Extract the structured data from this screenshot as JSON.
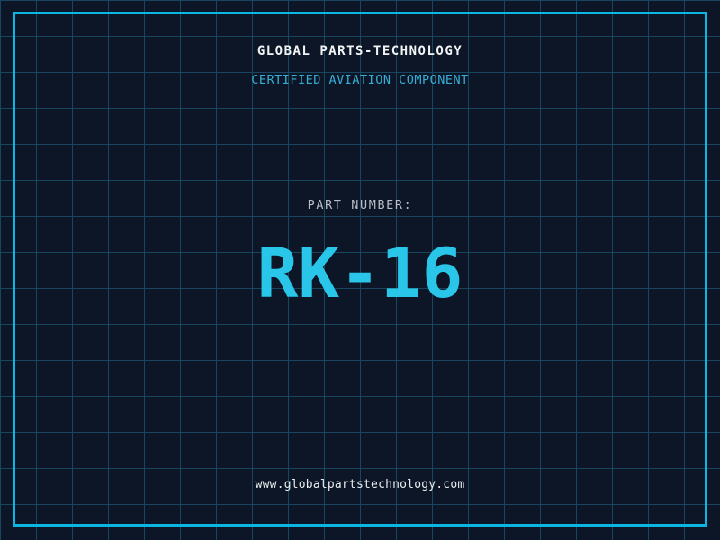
{
  "page": {
    "background_color": "#0d1626",
    "grid_line_color": "#17465e",
    "grid_cell_size_px": 40,
    "frame_color": "#0cb6e2"
  },
  "label": {
    "company_name": "GLOBAL PARTS-TECHNOLOGY",
    "certification": "CERTIFIED AVIATION COMPONENT",
    "part_number_label": "PART NUMBER:",
    "part_number": "RK-16",
    "website": "www.globalpartstechnology.com"
  },
  "colors": {
    "company_name": "#f2f4f6",
    "certification": "#35aed6",
    "part_number_label": "#b9bec8",
    "part_number": "#29c6ea",
    "website": "#e9edf0"
  }
}
